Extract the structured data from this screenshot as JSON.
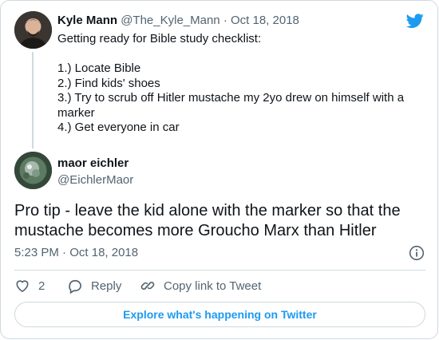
{
  "parent_tweet": {
    "author_name": "Kyle Mann",
    "author_handle": "@The_Kyle_Mann",
    "separator": " · ",
    "date": "Oct 18, 2018",
    "lines": [
      "Getting ready for Bible study checklist:",
      "",
      "1.) Locate Bible",
      "2.) Find kids' shoes",
      "3.) Try to scrub off Hitler mustache my 2yo drew on himself with a marker",
      "4.) Get everyone in car"
    ]
  },
  "main_tweet": {
    "author_name": "maor eichler",
    "author_handle": "@EichlerMaor",
    "text": "Pro tip - leave the kid alone with the marker so that the mustache becomes more Groucho Marx than Hitler",
    "time": "5:23 PM",
    "separator": " · ",
    "date": "Oct 18, 2018"
  },
  "actions": {
    "like_count": "2",
    "reply_label": "Reply",
    "copy_label": "Copy link to Tweet"
  },
  "explore_label": "Explore what's happening on Twitter",
  "colors": {
    "accent": "#1d9bf0",
    "text": "#0f1419",
    "muted": "#536471",
    "border": "#cfd9de"
  },
  "icons": [
    "twitter-bird-icon",
    "info-icon",
    "heart-icon",
    "reply-bubble-icon",
    "link-icon"
  ]
}
